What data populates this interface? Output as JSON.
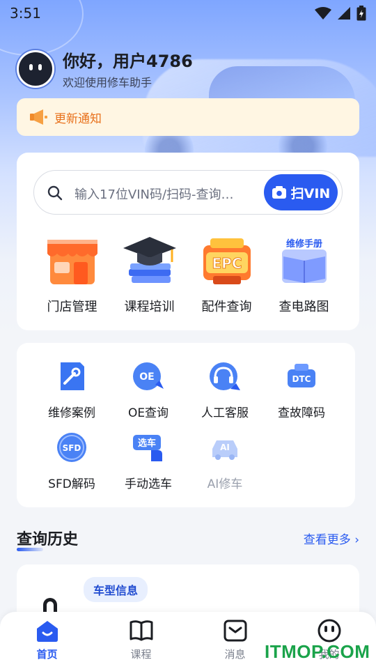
{
  "status_bar": {
    "time": "3:51"
  },
  "greeting": {
    "title": "你好，用户4786",
    "subtitle": "欢迎使用修车助手"
  },
  "notice": {
    "text": "更新通知"
  },
  "search": {
    "placeholder": "输入17位VIN码/扫码-查询…",
    "scan_label": "扫VIN"
  },
  "main_features": [
    {
      "label": "门店管理",
      "icon": "store-icon"
    },
    {
      "label": "课程培训",
      "icon": "graduation-cap-icon"
    },
    {
      "label": "配件查询",
      "icon": "epc-engine-icon",
      "badge": "EPC"
    },
    {
      "label": "查电路图",
      "icon": "repair-manual-icon",
      "badge": "维修手册"
    }
  ],
  "tools": [
    {
      "label": "维修案例",
      "icon": "wrench-doc-icon",
      "enabled": true
    },
    {
      "label": "OE查询",
      "icon": "oe-icon",
      "badge": "OE",
      "enabled": true
    },
    {
      "label": "人工客服",
      "icon": "headset-icon",
      "enabled": true
    },
    {
      "label": "查故障码",
      "icon": "dtc-engine-icon",
      "badge": "DTC",
      "enabled": true
    },
    {
      "label": "SFD解码",
      "icon": "sfd-icon",
      "badge": "SFD",
      "enabled": true
    },
    {
      "label": "手动选车",
      "icon": "select-car-icon",
      "badge": "选车",
      "enabled": true
    },
    {
      "label": "AI修车",
      "icon": "ai-car-icon",
      "badge": "AI",
      "enabled": false
    }
  ],
  "history": {
    "title": "查询历史",
    "more": "查看更多 ›",
    "tag": "车型信息"
  },
  "tabbar": [
    {
      "label": "首页",
      "icon": "home-icon",
      "active": true
    },
    {
      "label": "课程",
      "icon": "book-icon",
      "active": false
    },
    {
      "label": "消息",
      "icon": "message-icon",
      "active": false
    },
    {
      "label": "我的",
      "icon": "profile-icon",
      "active": false
    }
  ],
  "watermark": "ITMOP.COM",
  "colors": {
    "primary": "#2a5bf0",
    "notice": "#e8711c",
    "notice_bg": "#fff6e3"
  }
}
